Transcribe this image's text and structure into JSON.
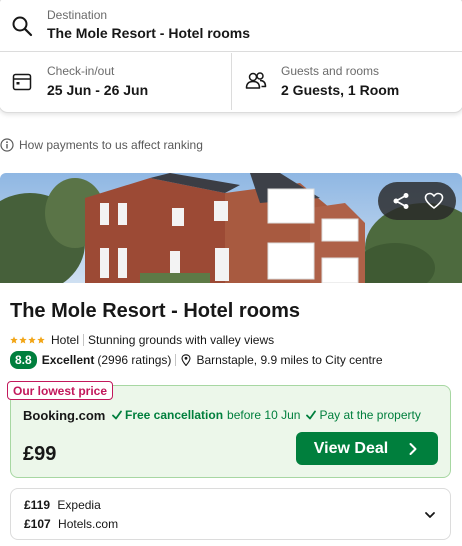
{
  "search": {
    "destination_label": "Destination",
    "destination_value": "The Mole Resort - Hotel rooms",
    "dates_label": "Check-in/out",
    "dates_value": "25 Jun - 26 Jun",
    "guests_label": "Guests and rooms",
    "guests_value": "2 Guests, 1 Room"
  },
  "info": {
    "text": "How payments to us affect ranking"
  },
  "hotel": {
    "name": "The Mole Resort - Hotel rooms",
    "stars": 4,
    "type": "Hotel",
    "tagline": "Stunning grounds with valley views",
    "rating": "8.8",
    "rating_word": "Excellent",
    "rating_count": "(2996 ratings)",
    "location": "Barnstaple, 9.9 miles to City centre"
  },
  "deal": {
    "tag": "Our lowest price",
    "provider": "Booking.com",
    "perk1_strong": "Free cancellation",
    "perk1_rest": "before 10 Jun",
    "perk2": "Pay at the property",
    "price": "£99",
    "button_label": "View Deal"
  },
  "other_prices": [
    {
      "price": "£119",
      "provider": "Expedia"
    },
    {
      "price": "£107",
      "provider": "Hotels.com"
    }
  ],
  "colors": {
    "accent_green": "#007f3d",
    "deal_bg": "#ecf7ea",
    "tag_pink": "#c2185b"
  },
  "icons": {
    "destination": "search-icon",
    "dates": "calendar-icon",
    "guests": "people-icon",
    "info": "info-icon",
    "share": "share-icon",
    "favorite": "heart-icon",
    "location": "pin-icon",
    "perk": "check-icon",
    "button": "chevron-right-icon",
    "expand": "chevron-down-icon"
  }
}
